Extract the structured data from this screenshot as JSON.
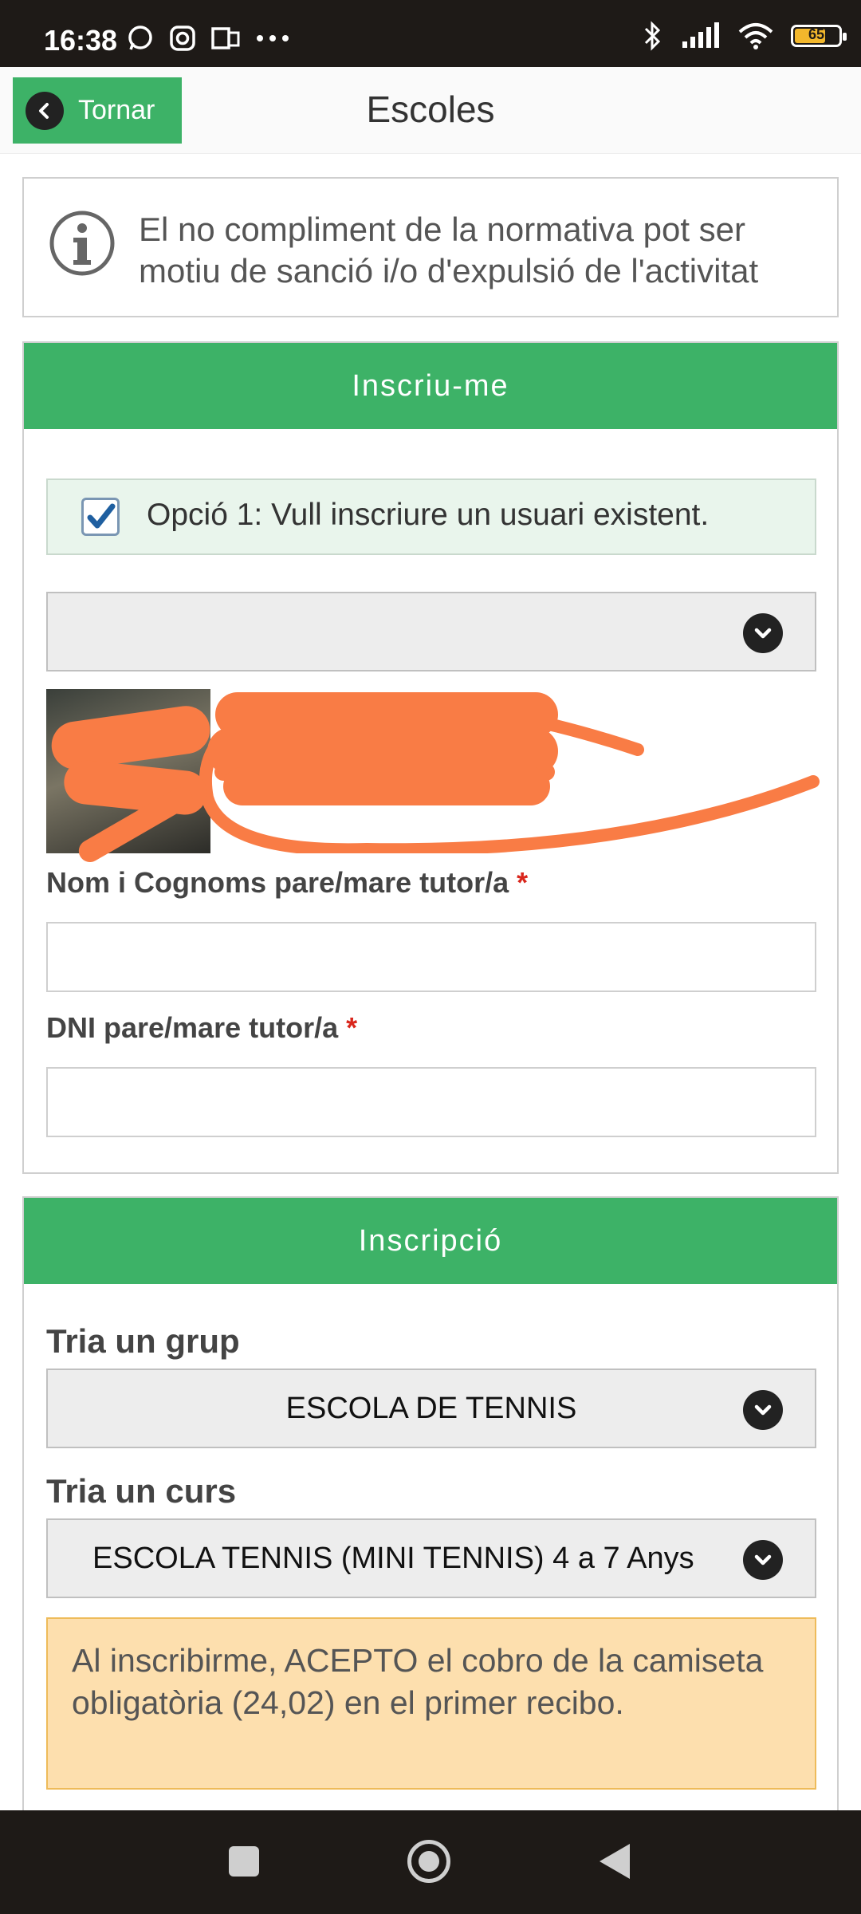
{
  "status_bar": {
    "time": "16:38",
    "battery_level": "65"
  },
  "header": {
    "back_label": "Tornar",
    "title": "Escoles"
  },
  "info": {
    "text": "El no compliment de la normativa pot ser motiu de sanció i/o d'expulsió de l'activitat"
  },
  "enroll_panel": {
    "title": "Inscriu-me",
    "option1_label": "Opció 1: Vull inscriure un usuari existent.",
    "option1_checked": true,
    "guardian_name_label": "Nom i Cognoms pare/mare tutor/a",
    "guardian_dni_label": "DNI pare/mare tutor/a",
    "required_mark": "*"
  },
  "registration_panel": {
    "title": "Inscripció",
    "group_label": "Tria un grup",
    "group_selected": "ESCOLA DE TENNIS",
    "course_label": "Tria un curs",
    "course_selected": "ESCOLA TENNIS (MINI TENNIS) 4 a 7 Anys",
    "notice": "Al inscribirme, ACEPTO el cobro de la camiseta obligatòria (24,02) en el primer recibo."
  },
  "colors": {
    "accent_green": "#3db267",
    "notice_bg": "#fddfae",
    "required_red": "#d9261c",
    "redaction_orange": "#f97c45"
  }
}
